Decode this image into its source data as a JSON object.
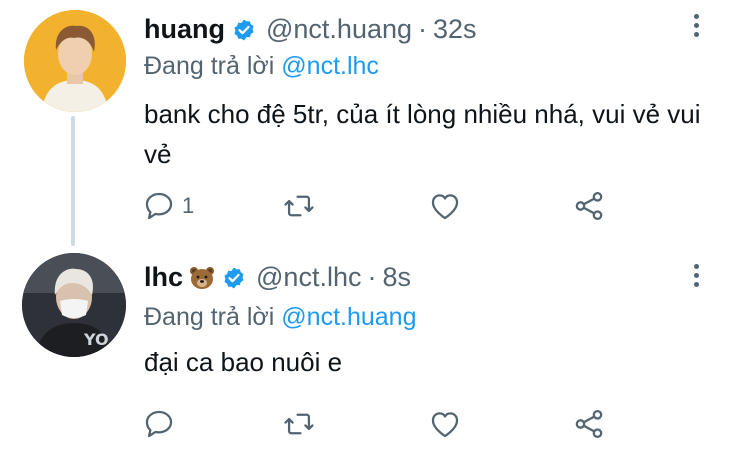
{
  "tweets": [
    {
      "name": "huang",
      "handle": "@nct.huang",
      "separator": "·",
      "time": "32s",
      "reply_prefix": "Đang trả lời",
      "reply_mention": "@nct.lhc",
      "text": "bank cho đệ 5tr, của ít lòng nhiều nhá, vui vẻ vui vẻ",
      "reply_count": "1",
      "avatar_icon": "profile-photo"
    },
    {
      "name": "lhc",
      "handle": "@nct.lhc",
      "separator": "·",
      "time": "8s",
      "reply_prefix": "Đang trả lời",
      "reply_mention": "@nct.huang",
      "text": "đại ca bao nuôi e",
      "reply_count": "",
      "avatar_icon": "profile-photo"
    }
  ],
  "icons": {
    "verified": "verified-badge-icon",
    "reply": "reply-icon",
    "retweet": "retweet-icon",
    "like": "heart-icon",
    "share": "share-icon",
    "more": "more-vertical-icon",
    "bear": "bear-emoji"
  },
  "colors": {
    "link": "#1d9bf0",
    "secondary_text": "#536471",
    "primary_text": "#0f1419",
    "thread_line": "#cfd9de"
  }
}
